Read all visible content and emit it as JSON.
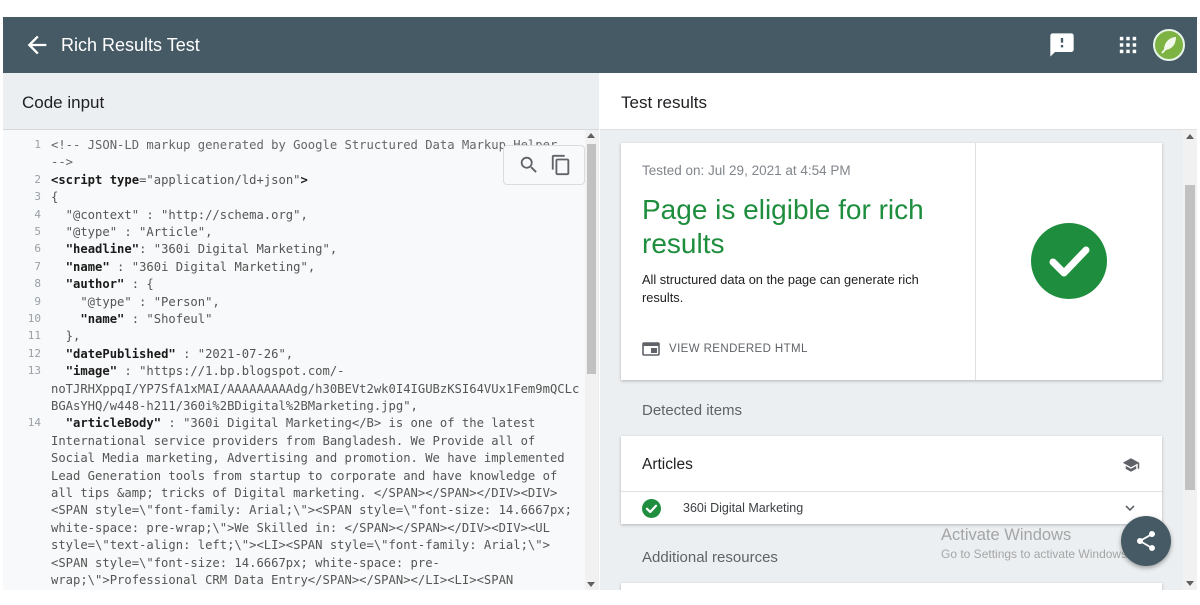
{
  "appbar": {
    "title": "Rich Results Test",
    "icons": [
      "back-arrow-icon",
      "feedback-icon",
      "apps-grid-icon",
      "account-avatar"
    ]
  },
  "left_pane": {
    "title": "Code input",
    "code_lines": [
      {
        "n": "1",
        "html": "<span class=\"c\">&lt;!-- JSON-LD markup generated by Google Structured Data Markup Helper</span>"
      },
      {
        "n": "",
        "html": "<span class=\"c\">--&gt;</span>"
      },
      {
        "n": "2",
        "html": "<span class=\"k\">&lt;script</span> <span class=\"k\">type</span>=\"application/ld+json\"<span class=\"k\">&gt;</span>"
      },
      {
        "n": "3",
        "html": "{"
      },
      {
        "n": "4",
        "html": "  \"@context\" : \"http://schema.org\","
      },
      {
        "n": "5",
        "html": "  \"@type\" : \"Article\","
      },
      {
        "n": "6",
        "html": "  <span class=\"k\">\"headline\"</span>: \"360i Digital Marketing\","
      },
      {
        "n": "7",
        "html": "  <span class=\"k\">\"name\"</span> : \"360i Digital Marketing\","
      },
      {
        "n": "8",
        "html": "  <span class=\"k\">\"author\"</span> : {"
      },
      {
        "n": "9",
        "html": "    \"@type\" : \"Person\","
      },
      {
        "n": "10",
        "html": "    <span class=\"k\">\"name\"</span> : \"Shofeul\""
      },
      {
        "n": "11",
        "html": "  },"
      },
      {
        "n": "12",
        "html": "  <span class=\"k\">\"datePublished\"</span> : \"2021-07-26\","
      },
      {
        "n": "13",
        "html": "  <span class=\"k\">\"image\"</span> : \"https://1.bp.blogspot.com/-"
      },
      {
        "n": "",
        "html": "noTJRHXppqI/YP7SfA1xMAI/AAAAAAAAAdg/h30BEVt2wk0I4IGUBzKSI64VUx1Fem9mQCLc"
      },
      {
        "n": "",
        "html": "BGAsYHQ/w448-h211/360i%2BDigital%2BMarketing.jpg\","
      },
      {
        "n": "14",
        "html": "  <span class=\"k\">\"articleBody\"</span> : \"360i Digital Marketing&lt;/B&gt; is one of the latest"
      },
      {
        "n": "",
        "html": "International service providers from Bangladesh. We Provide all of"
      },
      {
        "n": "",
        "html": "Social Media marketing, Advertising and promotion. We have implemented"
      },
      {
        "n": "",
        "html": "Lead Generation tools from startup to corporate and have knowledge of"
      },
      {
        "n": "",
        "html": "all tips &amp;amp; tricks of Digital marketing. &lt;/SPAN&gt;&lt;/SPAN&gt;&lt;/DIV&gt;&lt;DIV&gt;"
      },
      {
        "n": "",
        "html": "&lt;SPAN style=\\\"font-family: Arial;\\\"&gt;&lt;SPAN style=\\\"font-size: 14.6667px;"
      },
      {
        "n": "",
        "html": "white-space: pre-wrap;\\\"&gt;We Skilled in: &lt;/SPAN&gt;&lt;/SPAN&gt;&lt;/DIV&gt;&lt;DIV&gt;&lt;UL"
      },
      {
        "n": "",
        "html": "style=\\\"text-align: left;\\\"&gt;&lt;LI&gt;&lt;SPAN style=\\\"font-family: Arial;\\\"&gt;"
      },
      {
        "n": "",
        "html": "&lt;SPAN style=\\\"font-size: 14.6667px; white-space: pre-"
      },
      {
        "n": "",
        "html": "wrap;\\\"&gt;Professional CRM Data Entry&lt;/SPAN&gt;&lt;/SPAN&gt;&lt;/LI&gt;&lt;LI&gt;&lt;SPAN"
      }
    ],
    "tools": [
      "search-icon",
      "copy-icon"
    ]
  },
  "right_pane": {
    "title": "Test results",
    "tested_on": "Tested on: Jul 29, 2021 at 4:54 PM",
    "headline": "Page is eligible for rich results",
    "description": "All structured data on the page can generate rich results.",
    "view_html_label": "VIEW RENDERED HTML",
    "detected_items_label": "Detected items",
    "articles_title": "Articles",
    "article_item": "360i Digital Marketing",
    "additional_resources_label": "Additional resources"
  },
  "watermark": {
    "line1": "Activate Windows",
    "line2": "Go to Settings to activate Windows."
  },
  "colors": {
    "appbar": "#455a64",
    "success_green": "#1e8e3e",
    "pane_bg": "#eceff1"
  }
}
